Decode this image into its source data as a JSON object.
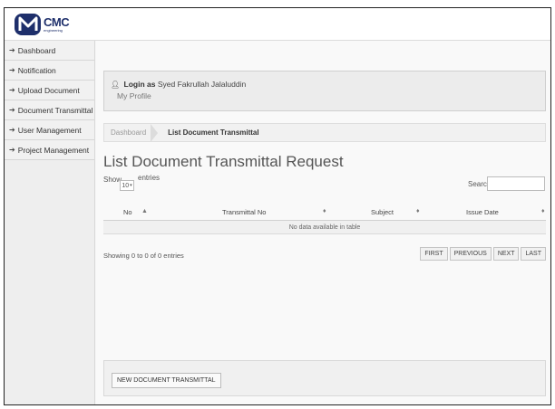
{
  "header": {
    "logo_text": "CMC",
    "logo_subtext": "engineering"
  },
  "sidebar": {
    "items": [
      {
        "label": "Dashboard",
        "icon": "arrow-right-icon"
      },
      {
        "label": "Notification",
        "icon": "arrow-right-icon"
      },
      {
        "label": "Upload Document",
        "icon": "arrow-right-icon"
      },
      {
        "label": "Document Transmittal",
        "icon": "arrow-right-icon"
      },
      {
        "label": "User Management",
        "icon": "arrow-right-icon"
      },
      {
        "label": "Project Management",
        "icon": "arrow-right-icon"
      }
    ]
  },
  "login": {
    "prefix": "Login as",
    "user": "Syed Fakrullah Jalaluddin",
    "profile_link": "My Profile"
  },
  "breadcrumb": {
    "items": [
      "Dashboard",
      "List Document Transmittal"
    ]
  },
  "page": {
    "title": "List Document Transmittal Request"
  },
  "table_controls": {
    "show_label": "Show",
    "page_length": "10",
    "entries_label": "entries",
    "search_label": "Search:",
    "search_value": ""
  },
  "table": {
    "columns": [
      "No",
      "Transmittal No",
      "Subject",
      "Issue Date"
    ],
    "rows": [],
    "empty_message": "No data available in table"
  },
  "pagination": {
    "info": "Showing 0 to 0 of 0 entries",
    "buttons": [
      "FIRST",
      "PREVIOUS",
      "NEXT",
      "LAST"
    ]
  },
  "actions": {
    "new_button": "NEW DOCUMENT TRANSMITTAL"
  },
  "colors": {
    "brand": "#1e2f6b",
    "sidebar_bg": "#eeeeee",
    "content_bg": "#f9f9f9"
  }
}
